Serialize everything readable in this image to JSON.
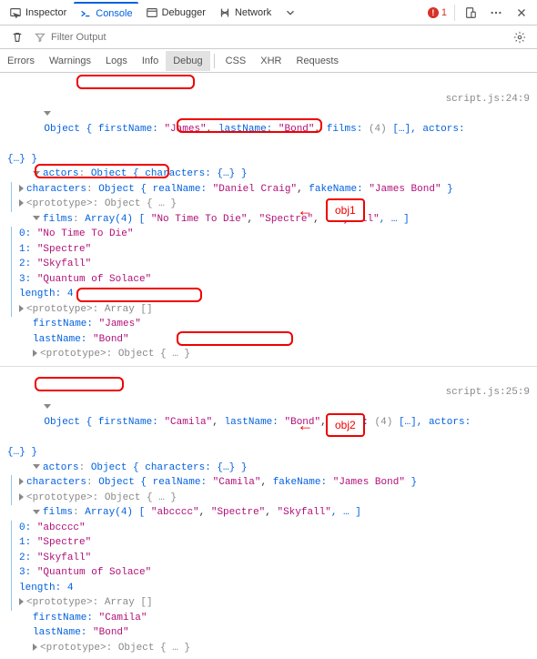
{
  "toolbar": {
    "inspector": "Inspector",
    "console": "Console",
    "debugger": "Debugger",
    "network": "Network",
    "error_count": "1"
  },
  "filter": {
    "placeholder": "Filter Output"
  },
  "tabs": {
    "errors": "Errors",
    "warnings": "Warnings",
    "logs": "Logs",
    "info": "Info",
    "debug": "Debug",
    "css": "CSS",
    "xhr": "XHR",
    "requests": "Requests"
  },
  "obj1": {
    "source": "script.js:24:9",
    "head_a": "Object { ",
    "firstName_k": "firstName:",
    "firstName_v": "\"James\"",
    "lastName_k": "lastName:",
    "lastName_v": "\"Bond\"",
    "films_k": "films:",
    "films_count": "(4)",
    "tail_a": "[…], actors:",
    "brace": "{…} }",
    "actors_line": "actors: Object { characters: {…} }",
    "chars_a": "characters: Object { ",
    "realName_k": "realName:",
    "realName_v": "\"Daniel Craig\"",
    "fakeName_k": "fakeName:",
    "fakeName_v": "\"James Bond\"",
    "chars_b": " }",
    "proto": "<prototype>: Object { … }",
    "films_line": "films: Array(4) [ \"No Time To Die\", \"Spectre\", \"Skyfall\", … ]",
    "f0k": "0:",
    "f0v": "\"No Time To Die\"",
    "f1k": "1:",
    "f1v": "\"Spectre\"",
    "f2k": "2:",
    "f2v": "\"Skyfall\"",
    "f3k": "3:",
    "f3v": "\"Quantum of Solace\"",
    "len_k": "length:",
    "len_v": "4",
    "proto_arr": "<prototype>: Array []",
    "fn_k": "firstName:",
    "fn_v": "\"James\"",
    "ln_k": "lastName:",
    "ln_v": "\"Bond\"",
    "proto2": "<prototype>: Object { … }"
  },
  "obj2": {
    "source": "script.js:25:9",
    "head_a": "Object { ",
    "firstName_k": "firstName:",
    "firstName_v": "\"Camila\"",
    "lastName_k": "lastName:",
    "lastName_v": "\"Bond\"",
    "films_k": "films:",
    "films_count": "(4)",
    "tail_a": "[…], actors:",
    "brace": "{…} }",
    "actors_line": "actors: Object { characters: {…} }",
    "chars_a": "characters: Object { ",
    "realName_k": "realName:",
    "realName_v": "\"Camila\"",
    "fakeName_k": "fakeName:",
    "fakeName_v": "\"James Bond\"",
    "chars_b": " }",
    "proto": "<prototype>: Object { … }",
    "films_line": "films: Array(4) [ \"abcccc\", \"Spectre\", \"Skyfall\", … ]",
    "f0k": "0:",
    "f0v": "\"abcccc\"",
    "f1k": "1:",
    "f1v": "\"Spectre\"",
    "f2k": "2:",
    "f2v": "\"Skyfall\"",
    "f3k": "3:",
    "f3v": "\"Quantum of Solace\"",
    "len_k": "length:",
    "len_v": "4",
    "proto_arr": "<prototype>: Array []",
    "fn_k": "firstName:",
    "fn_v": "\"Camila\"",
    "ln_k": "lastName:",
    "ln_v": "\"Bond\"",
    "proto2": "<prototype>: Object { … }"
  },
  "annot": {
    "obj1": "obj1",
    "obj2": "obj2"
  }
}
